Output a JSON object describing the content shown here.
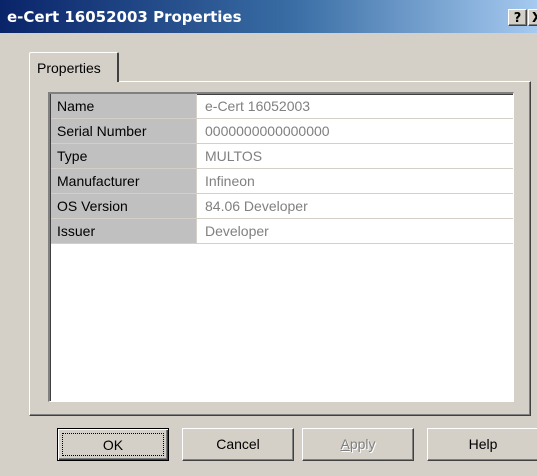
{
  "window": {
    "title": "e-Cert 16052003 Properties",
    "help_glyph": "?",
    "close_glyph": "X"
  },
  "tabs": [
    {
      "label": "Properties",
      "selected": true
    }
  ],
  "properties": [
    {
      "name": "Name",
      "value": "e-Cert 16052003"
    },
    {
      "name": "Serial Number",
      "value": "0000000000000000"
    },
    {
      "name": "Type",
      "value": "MULTOS"
    },
    {
      "name": "Manufacturer",
      "value": "Infineon"
    },
    {
      "name": "OS Version",
      "value": "84.06 Developer"
    },
    {
      "name": "Issuer",
      "value": "Developer"
    }
  ],
  "buttons": {
    "ok": "OK",
    "cancel": "Cancel",
    "apply_first": "A",
    "apply_rest": "pply",
    "help": "Help"
  }
}
